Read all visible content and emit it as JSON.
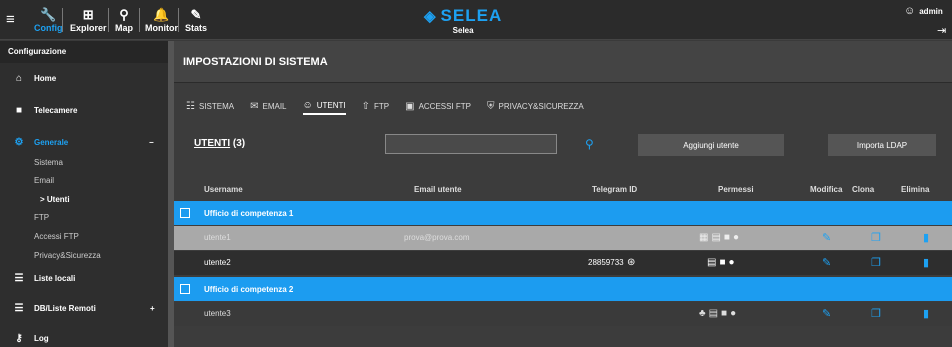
{
  "topbar": {
    "menu_icon": "hamburger-icon",
    "items": [
      {
        "label": "Config",
        "icon": "wrench-icon"
      },
      {
        "label": "Explorer",
        "icon": "explorer-icon"
      },
      {
        "label": "Map",
        "icon": "map-pin-icon"
      },
      {
        "label": "Monitor",
        "icon": "bell-icon"
      },
      {
        "label": "Stats",
        "icon": "stats-icon"
      }
    ],
    "brand": "SELEA",
    "brand_sub": "Selea",
    "user": "admin",
    "accent": "#1c9cf0"
  },
  "sidebar": {
    "header": "Configurazione",
    "items": [
      {
        "label": "Home",
        "icon": "home-icon"
      },
      {
        "label": "Telecamere",
        "icon": "camera-icon"
      },
      {
        "label": "Generale",
        "icon": "gear-icon",
        "toggle": "−"
      },
      {
        "label": "Liste locali",
        "icon": "list-icon"
      },
      {
        "label": "DB/Liste Remoti",
        "icon": "db-list-icon",
        "toggle": "+"
      },
      {
        "label": "Log",
        "icon": "key-icon"
      }
    ],
    "sub_items": [
      "Sistema",
      "Email",
      "> Utenti",
      "FTP",
      "Accessi FTP",
      "Privacy&Sicurezza"
    ]
  },
  "main": {
    "title": "IMPOSTAZIONI DI SISTEMA",
    "tabs": [
      {
        "label": "SISTEMA",
        "icon": "sliders-icon"
      },
      {
        "label": "EMAIL",
        "icon": "mail-icon"
      },
      {
        "label": "UTENTI",
        "icon": "users-icon"
      },
      {
        "label": "FTP",
        "icon": "upload-icon"
      },
      {
        "label": "ACCESSI FTP",
        "icon": "folder-icon"
      },
      {
        "label": "PRIVACY&SICUREZZA",
        "icon": "shield-icon"
      }
    ],
    "users_title": "UTENTI",
    "users_count": "(3)",
    "search_value": "",
    "add_user_label": "Aggiungi utente",
    "import_ldap_label": "Importa LDAP",
    "columns": [
      "Username",
      "Email utente",
      "Telegram ID",
      "Permessi",
      "Modifica",
      "Clona",
      "Elimina"
    ],
    "groups": [
      {
        "name": "Ufficio di competenza 1"
      },
      {
        "name": "Ufficio di competenza 2"
      }
    ],
    "users": [
      {
        "username": "utente1",
        "email": "prova@prova.com",
        "telegram": ""
      },
      {
        "username": "utente2",
        "email": "",
        "telegram": "28859733"
      },
      {
        "username": "utente3",
        "email": "",
        "telegram": ""
      }
    ]
  }
}
